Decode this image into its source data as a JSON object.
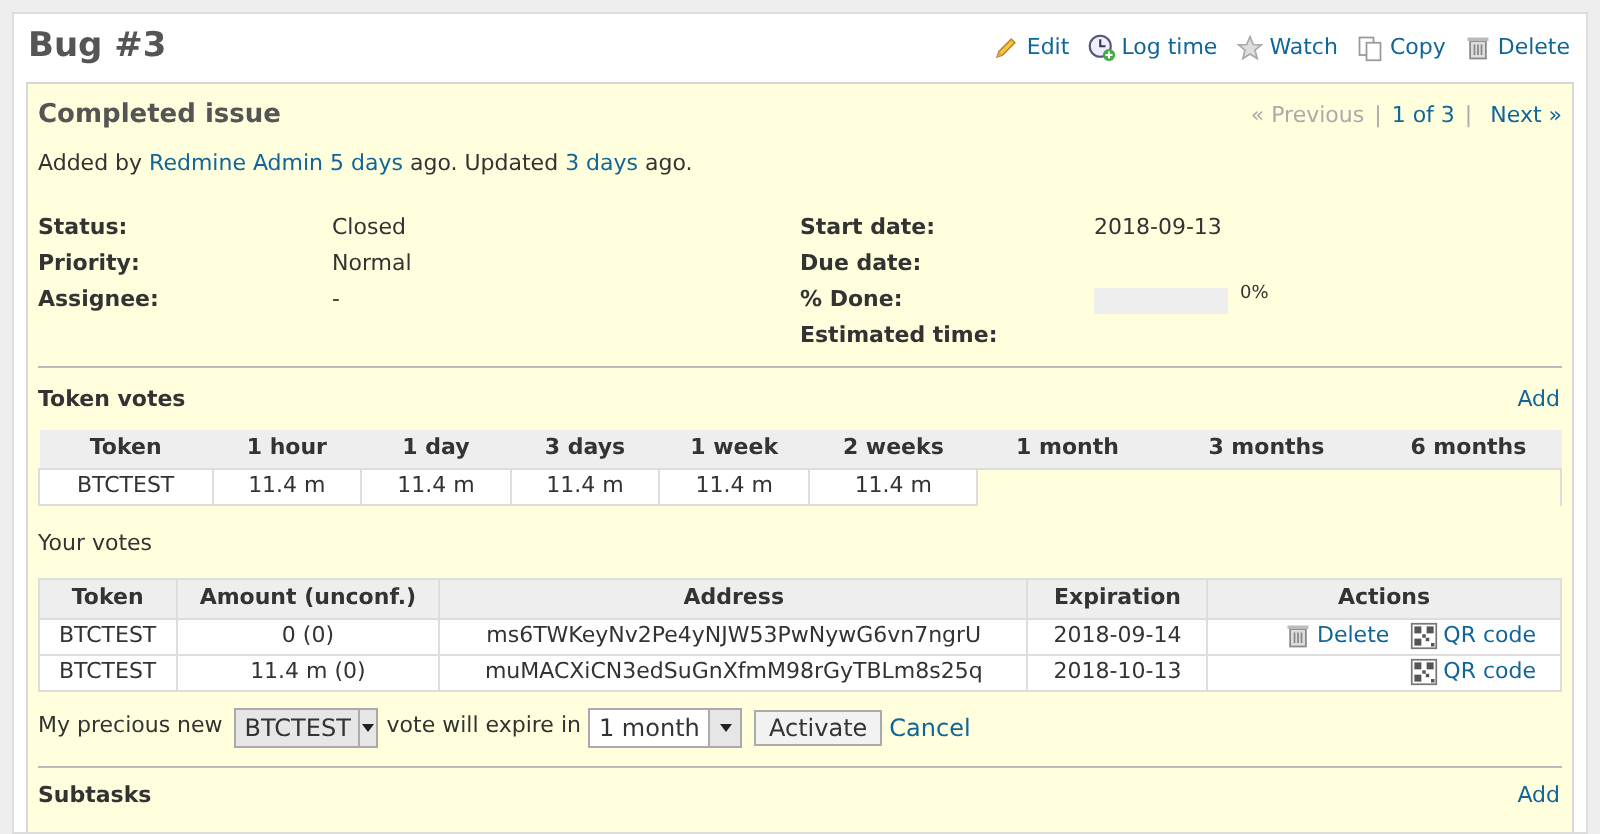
{
  "title": "Bug #3",
  "contextual": [
    {
      "kind": "edit",
      "label": "Edit"
    },
    {
      "kind": "log",
      "label": "Log time"
    },
    {
      "kind": "watch",
      "label": "Watch"
    },
    {
      "kind": "copy",
      "label": "Copy"
    },
    {
      "kind": "delete",
      "label": "Delete"
    }
  ],
  "issue": {
    "subject": "Completed issue",
    "nav": {
      "previous": "« Previous",
      "separator_1": "|",
      "position": "1 of 3",
      "separator_2": "|",
      "next": "Next »"
    },
    "author_line": {
      "prefix": "Added by",
      "author": "Redmine Admin",
      "created": "5 days",
      "mid": "ago. Updated",
      "updated": "3 days",
      "suffix": "ago."
    },
    "attributes_left": [
      {
        "label": "Status:",
        "value": "Closed"
      },
      {
        "label": "Priority:",
        "value": "Normal"
      },
      {
        "label": "Assignee:",
        "value": "-"
      }
    ],
    "attributes_right": [
      {
        "label": "Start date:",
        "value": "2018-09-13"
      },
      {
        "label": "Due date:"
      },
      {
        "label": "% Done:",
        "kind": "progress",
        "level": 0,
        "value": "0%"
      },
      {
        "label": "Estimated time:"
      }
    ]
  },
  "token_votes": {
    "heading": "Token votes",
    "add": "Add",
    "columns": [
      "Token",
      "1 hour",
      "1 day",
      "3 days",
      "1 week",
      "2 weeks",
      "1 month",
      "3 months",
      "6 months"
    ],
    "rows": [
      [
        "BTCTEST",
        "11.4 m",
        "11.4 m",
        "11.4 m",
        "11.4 m",
        "11.4 m"
      ]
    ]
  },
  "your_votes": {
    "heading": "Your votes",
    "columns": [
      "Token",
      "Amount (unconf.)",
      "Address",
      "Expiration",
      "Actions"
    ],
    "rows": [
      {
        "cells": [
          "BTCTEST",
          "0 (0)",
          "ms6TWKeyNv2Pe4yNJW53PwNywG6vn7ngrU",
          "2018-09-14"
        ],
        "actions": [
          {
            "kind": "delete",
            "label": "Delete"
          },
          {
            "kind": "qr",
            "label": "QR code"
          }
        ]
      },
      {
        "cells": [
          "BTCTEST",
          "11.4 m (0)",
          "muMACXiCN3edSuGnXfmM98rGyTBLm8s25q",
          "2018-10-13"
        ],
        "actions": [
          {
            "kind": "qr",
            "label": "QR code"
          }
        ]
      }
    ]
  },
  "vote_form": {
    "prefix": "My precious new",
    "token": "BTCTEST",
    "middle": "vote will expire in",
    "period": "1 month",
    "activate": "Activate",
    "cancel": "Cancel"
  },
  "subtasks": {
    "heading": "Subtasks",
    "add": "Add"
  }
}
